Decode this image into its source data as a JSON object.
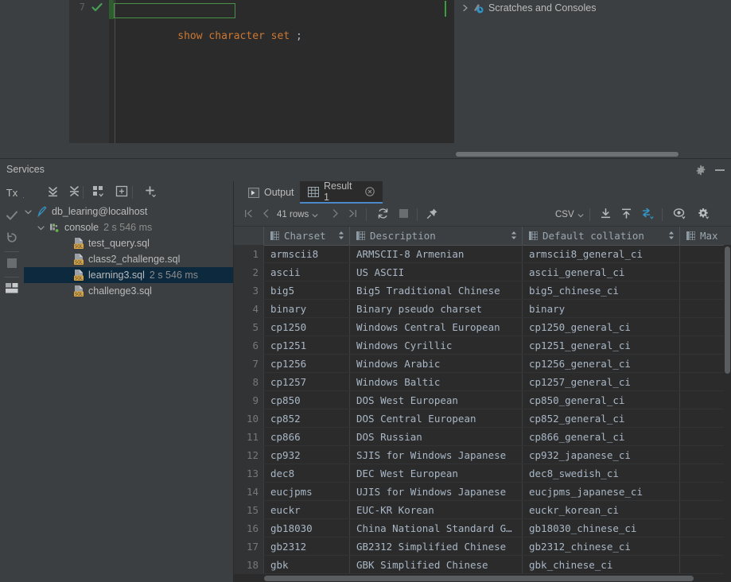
{
  "editor": {
    "line_number": "7",
    "code_keyword": "show character set",
    "code_rest": " ;",
    "gutter_check_icon": "check-icon"
  },
  "project_tree_right": {
    "expand_icon": "chevron-right-icon",
    "node_icon": "scratches-icon",
    "label": "Scratches and Consoles"
  },
  "services": {
    "title": "Services",
    "gear_icon": "gear-icon",
    "minimize_icon": "minimize-icon"
  },
  "left_strip": {
    "tx_label": "Tx",
    "buttons": [
      {
        "name": "tx-dropdown",
        "label": "Tx"
      },
      {
        "name": "commit-button",
        "label": "check-icon"
      },
      {
        "name": "rollback-button",
        "label": "rollback-icon"
      },
      {
        "name": "stop-button",
        "label": "stop-icon"
      },
      {
        "name": "layout-button",
        "label": "layout-icon"
      }
    ]
  },
  "tree_toolbar": {
    "buttons": [
      {
        "name": "expand-all-button",
        "icon": "expand-all-icon"
      },
      {
        "name": "collapse-all-button",
        "icon": "collapse-all-icon"
      },
      {
        "name": "group-by-button",
        "icon": "group-by-icon"
      },
      {
        "name": "add-frame-button",
        "icon": "add-frame-icon"
      },
      {
        "name": "add-button",
        "icon": "plus-icon"
      }
    ]
  },
  "tree": {
    "items": [
      {
        "name": "connection-node",
        "icon": "datasource-icon",
        "label": "db_learing@localhost",
        "sub": "",
        "indent": 10,
        "expanded": true,
        "selected": false
      },
      {
        "name": "console-node",
        "icon": "console-icon",
        "label": "console",
        "sub": "2 s 546 ms",
        "indent": 28,
        "expanded": true,
        "selected": false
      },
      {
        "name": "sql-file-node",
        "icon": "sql-file-icon",
        "label": "test_query.sql",
        "sub": "",
        "indent": 58,
        "expanded": null,
        "selected": false
      },
      {
        "name": "sql-file-node",
        "icon": "sql-file-icon",
        "label": "class2_challenge.sql",
        "sub": "",
        "indent": 58,
        "expanded": null,
        "selected": false
      },
      {
        "name": "sql-file-node",
        "icon": "sql-file-icon",
        "label": "learning3.sql",
        "sub": "2 s 546 ms",
        "indent": 58,
        "expanded": null,
        "selected": true
      },
      {
        "name": "sql-file-node",
        "icon": "sql-file-icon",
        "label": "challenge3.sql",
        "sub": "",
        "indent": 58,
        "expanded": null,
        "selected": false
      }
    ]
  },
  "result_tabs": [
    {
      "name": "tab-output",
      "label": "Output",
      "icon": "output-icon",
      "active": false,
      "closable": false
    },
    {
      "name": "tab-result-1",
      "label": "Result 1",
      "icon": "table-icon",
      "active": true,
      "closable": true
    }
  ],
  "result_toolbar": {
    "first_page_icon": "first-page-icon",
    "prev_page_icon": "prev-page-icon",
    "rows_label": "41 rows",
    "rows_chevron": "chevron-down-icon",
    "next_page_icon": "next-page-icon",
    "last_page_icon": "last-page-icon",
    "reload_icon": "refresh-icon",
    "stop_icon": "stop-icon",
    "pin_icon": "pin-icon",
    "format_label": "CSV",
    "format_chevron": "chevron-down-icon",
    "export_icon": "download-icon",
    "import_icon": "upload-icon",
    "transpose_icon": "transpose-icon",
    "view_icon": "eye-icon",
    "settings_icon": "gear-icon"
  },
  "grid": {
    "columns": [
      {
        "name": "column-charset",
        "label": "Charset",
        "icon": "column-icon",
        "sortable": true
      },
      {
        "name": "column-description",
        "label": "Description",
        "icon": "column-icon",
        "sortable": true
      },
      {
        "name": "column-default-collation",
        "label": "Default collation",
        "icon": "column-icon",
        "sortable": true
      },
      {
        "name": "column-maxlen",
        "label": "Max",
        "icon": "column-icon",
        "sortable": false
      }
    ],
    "rows": [
      {
        "n": "1",
        "charset": "armscii8",
        "description": "ARMSCII-8 Armenian",
        "collation": "armscii8_general_ci",
        "maxlen": ""
      },
      {
        "n": "2",
        "charset": "ascii",
        "description": "US ASCII",
        "collation": "ascii_general_ci",
        "maxlen": ""
      },
      {
        "n": "3",
        "charset": "big5",
        "description": "Big5 Traditional Chinese",
        "collation": "big5_chinese_ci",
        "maxlen": ""
      },
      {
        "n": "4",
        "charset": "binary",
        "description": "Binary pseudo charset",
        "collation": "binary",
        "maxlen": ""
      },
      {
        "n": "5",
        "charset": "cp1250",
        "description": "Windows Central European",
        "collation": "cp1250_general_ci",
        "maxlen": ""
      },
      {
        "n": "6",
        "charset": "cp1251",
        "description": "Windows Cyrillic",
        "collation": "cp1251_general_ci",
        "maxlen": ""
      },
      {
        "n": "7",
        "charset": "cp1256",
        "description": "Windows Arabic",
        "collation": "cp1256_general_ci",
        "maxlen": ""
      },
      {
        "n": "8",
        "charset": "cp1257",
        "description": "Windows Baltic",
        "collation": "cp1257_general_ci",
        "maxlen": ""
      },
      {
        "n": "9",
        "charset": "cp850",
        "description": "DOS West European",
        "collation": "cp850_general_ci",
        "maxlen": ""
      },
      {
        "n": "10",
        "charset": "cp852",
        "description": "DOS Central European",
        "collation": "cp852_general_ci",
        "maxlen": ""
      },
      {
        "n": "11",
        "charset": "cp866",
        "description": "DOS Russian",
        "collation": "cp866_general_ci",
        "maxlen": ""
      },
      {
        "n": "12",
        "charset": "cp932",
        "description": "SJIS for Windows Japanese",
        "collation": "cp932_japanese_ci",
        "maxlen": ""
      },
      {
        "n": "13",
        "charset": "dec8",
        "description": "DEC West European",
        "collation": "dec8_swedish_ci",
        "maxlen": ""
      },
      {
        "n": "14",
        "charset": "eucjpms",
        "description": "UJIS for Windows Japanese",
        "collation": "eucjpms_japanese_ci",
        "maxlen": ""
      },
      {
        "n": "15",
        "charset": "euckr",
        "description": "EUC-KR Korean",
        "collation": "euckr_korean_ci",
        "maxlen": ""
      },
      {
        "n": "16",
        "charset": "gb18030",
        "description": "China National Standard G…",
        "collation": "gb18030_chinese_ci",
        "maxlen": ""
      },
      {
        "n": "17",
        "charset": "gb2312",
        "description": "GB2312 Simplified Chinese",
        "collation": "gb2312_chinese_ci",
        "maxlen": ""
      },
      {
        "n": "18",
        "charset": "gbk",
        "description": "GBK Simplified Chinese",
        "collation": "gbk_chinese_ci",
        "maxlen": ""
      }
    ]
  },
  "colors": {
    "panel_bg": "#3c3f41",
    "editor_bg": "#2b2b2b",
    "selection_blue": "#0d293e",
    "accent_blue": "#4a88c7",
    "keyword_orange": "#cc7832",
    "text": "#bbbbbb",
    "grid_text": "#a9b7c6",
    "run_green": "#499c54"
  }
}
